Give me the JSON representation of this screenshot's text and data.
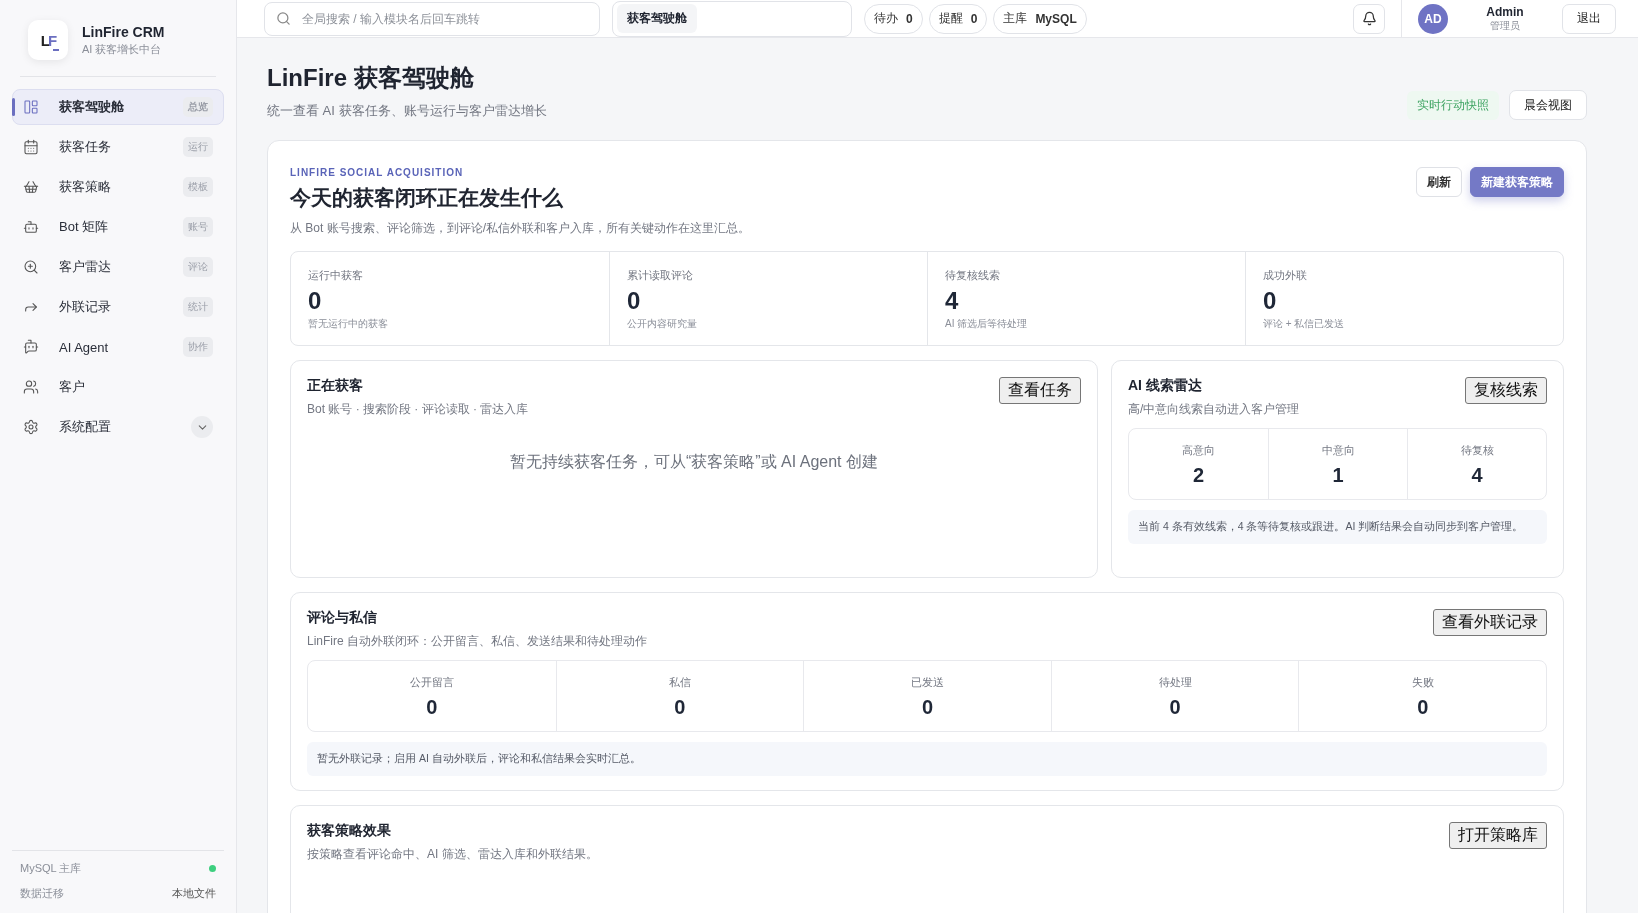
{
  "sidebar": {
    "brand": {
      "logo": "LF",
      "name": "LinFire CRM",
      "tagline": "AI 获客增长中台"
    },
    "items": [
      {
        "label": "获客驾驶舱",
        "badge": "总览",
        "selected": true
      },
      {
        "label": "获客任务",
        "badge": "运行",
        "selected": false
      },
      {
        "label": "获客策略",
        "badge": "模板",
        "selected": false
      },
      {
        "label": "Bot 矩阵",
        "badge": "账号",
        "selected": false
      },
      {
        "label": "客户雷达",
        "badge": "评论",
        "selected": false
      },
      {
        "label": "外联记录",
        "badge": "统计",
        "selected": false
      },
      {
        "label": "AI Agent",
        "badge": "协作",
        "selected": false
      },
      {
        "label": "客户",
        "selected": false
      }
    ],
    "config": {
      "label": "系统配置",
      "expanded": false
    },
    "footer": [
      {
        "kind": "status",
        "label": "MySQL 主库",
        "color": "#3ecf7f"
      },
      {
        "kind": "text",
        "label": "数据迁移",
        "value": "本地文件"
      }
    ]
  },
  "topbar": {
    "search": {
      "placeholder": "全局搜索 / 输入模块名后回车跳转"
    },
    "breadcrumb": "获客驾驶舱",
    "pills": [
      {
        "label": "待办",
        "value": "0"
      },
      {
        "label": "提醒",
        "value": "0"
      },
      {
        "label": "主库",
        "value": "MySQL"
      }
    ],
    "user": {
      "avatar": "AD",
      "name": "Admin",
      "role": "管理员"
    },
    "logout": "退出"
  },
  "header": {
    "title": "LinFire 获客驾驶舱",
    "subtitle": "统一查看 AI 获客任务、账号运行与客户雷达增长",
    "badge": "实时行动快照",
    "button": "晨会视图"
  },
  "hero": {
    "eyebrow": "LINFIRE SOCIAL ACQUISITION",
    "title": "今天的获客闭环正在发生什么",
    "description": "从 Bot 账号搜索、评论筛选，到评论/私信外联和客户入库，所有关键动作在这里汇总。",
    "buttons": [
      {
        "label": "刷新",
        "kind": "secondary"
      },
      {
        "label": "新建获客策略",
        "kind": "primary"
      }
    ],
    "stats": [
      {
        "label": "运行中获客",
        "value": "0",
        "note": "暂无运行中的获客"
      },
      {
        "label": "累计读取评论",
        "value": "0",
        "note": "公开内容研究量"
      },
      {
        "label": "待复核线索",
        "value": "4",
        "note": "AI 筛选后等待处理"
      },
      {
        "label": "成功外联",
        "value": "0",
        "note": "评论 + 私信已发送"
      }
    ]
  },
  "active": {
    "title": "正在获客",
    "subtitle": "Bot 账号 · 搜索阶段 · 评论读取 · 雷达入库",
    "button": "查看任务",
    "empty": "暂无持续获客任务，可从“获客策略”或 AI Agent 创建"
  },
  "radar": {
    "title": "AI 线索雷达",
    "subtitle": "高/中意向线索自动进入客户管理",
    "button": "复核线索",
    "metrics": [
      {
        "label": "高意向",
        "value": "2"
      },
      {
        "label": "中意向",
        "value": "1"
      },
      {
        "label": "待复核",
        "value": "4"
      }
    ],
    "note": "当前 4 条有效线索，4 条等待复核或跟进。AI 判断结果会自动同步到客户管理。"
  },
  "outreach": {
    "title": "评论与私信",
    "subtitle": "LinFire 自动外联闭环：公开留言、私信、发送结果和待处理动作",
    "button": "查看外联记录",
    "metrics": [
      {
        "label": "公开留言",
        "value": "0"
      },
      {
        "label": "私信",
        "value": "0"
      },
      {
        "label": "已发送",
        "value": "0"
      },
      {
        "label": "待处理",
        "value": "0"
      },
      {
        "label": "失败",
        "value": "0"
      }
    ],
    "note": "暂无外联记录；启用 AI 自动外联后，评论和私信结果会实时汇总。"
  },
  "strategy": {
    "title": "获客策略效果",
    "subtitle": "按策略查看评论命中、AI 筛选、雷达入库和外联结果。",
    "button": "打开策略库"
  }
}
